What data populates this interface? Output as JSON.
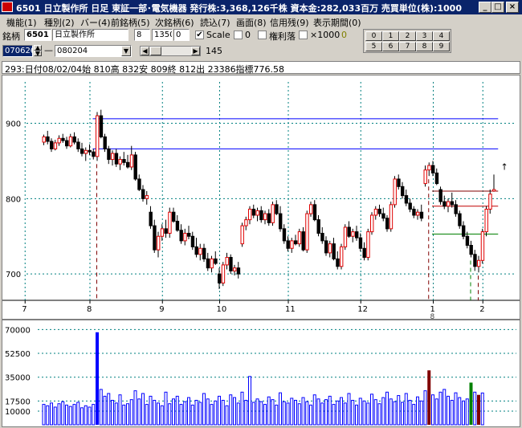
{
  "window": {
    "code": "6501",
    "title": "6501 日立製作所 日足 東証一部･電気機器 発行株:3,368,126千株 資本金:282,033百万 売買単位(株):1000",
    "min_btn": "_",
    "max_btn": "□",
    "close_btn": "×"
  },
  "menu": [
    "機能(1)",
    "種別(2)",
    "バー(4)",
    "前銘柄(5)",
    "次銘柄(6)",
    "読込(7)",
    "画面(8)",
    "信用残(9)",
    "表示期間(0)"
  ],
  "toolbar": {
    "code_label": "銘柄",
    "code_value": "6501",
    "name_value": "日立製作所",
    "field_a": "8",
    "field_b": "1350",
    "field_c": "0",
    "scale_label": "Scale",
    "zero_label": "0",
    "kinri_label": "権利落",
    "x1000_label": "×1000",
    "x1000_value": "0",
    "start_date": "070626",
    "end_date": "080204",
    "slider_value": "145",
    "scale_checked": "✔",
    "numkeys": [
      "0",
      "1",
      "2",
      "3",
      "4",
      "5",
      "6",
      "7",
      "8",
      "9"
    ]
  },
  "info_line": "293:日付08/02/04始 810高 832安 809終 812出 23386指標776.58",
  "chart_data": [
    {
      "type": "candlestick",
      "y_ticks": [
        "900",
        "800",
        "700"
      ],
      "ylim": [
        665,
        940
      ],
      "x_tick_labels": [
        "7",
        "8",
        "9",
        "10",
        "11",
        "12",
        "1",
        "2"
      ],
      "year_label": "8",
      "horizontal_levels": [
        906,
        866,
        810,
        790,
        753
      ],
      "last_marker": "↑",
      "colors": {
        "up": "#e00000",
        "down": "#000000",
        "level": "#0000ff",
        "grid": "#008080",
        "signal": "#800000",
        "signal2": "#008000"
      },
      "ohlc": [
        [
          875,
          885,
          871,
          882
        ],
        [
          882,
          890,
          872,
          876
        ],
        [
          876,
          880,
          862,
          866
        ],
        [
          866,
          878,
          864,
          874
        ],
        [
          874,
          884,
          870,
          880
        ],
        [
          880,
          886,
          874,
          877
        ],
        [
          877,
          882,
          866,
          870
        ],
        [
          870,
          886,
          868,
          882
        ],
        [
          882,
          888,
          872,
          875
        ],
        [
          875,
          880,
          862,
          866
        ],
        [
          866,
          874,
          856,
          860
        ],
        [
          860,
          868,
          850,
          864
        ],
        [
          864,
          872,
          858,
          862
        ],
        [
          862,
          866,
          852,
          856
        ],
        [
          856,
          915,
          850,
          910
        ],
        [
          910,
          918,
          880,
          882
        ],
        [
          882,
          886,
          862,
          866
        ],
        [
          866,
          870,
          846,
          852
        ],
        [
          852,
          864,
          844,
          860
        ],
        [
          860,
          866,
          842,
          846
        ],
        [
          846,
          856,
          838,
          852
        ],
        [
          852,
          862,
          844,
          848
        ],
        [
          848,
          858,
          840,
          842
        ],
        [
          842,
          870,
          838,
          858
        ],
        [
          858,
          862,
          824,
          826
        ],
        [
          826,
          832,
          810,
          812
        ],
        [
          812,
          818,
          796,
          800
        ],
        [
          800,
          810,
          792,
          804
        ],
        [
          782,
          790,
          760,
          764
        ],
        [
          764,
          772,
          728,
          732
        ],
        [
          732,
          756,
          722,
          750
        ],
        [
          750,
          766,
          744,
          760
        ],
        [
          760,
          772,
          748,
          754
        ],
        [
          754,
          788,
          748,
          782
        ],
        [
          782,
          788,
          768,
          770
        ],
        [
          770,
          778,
          756,
          758
        ],
        [
          758,
          766,
          740,
          744
        ],
        [
          744,
          760,
          738,
          754
        ],
        [
          754,
          764,
          746,
          750
        ],
        [
          750,
          756,
          732,
          736
        ],
        [
          736,
          748,
          722,
          726
        ],
        [
          726,
          740,
          718,
          734
        ],
        [
          734,
          740,
          716,
          720
        ],
        [
          720,
          728,
          704,
          708
        ],
        [
          708,
          724,
          702,
          720
        ],
        [
          720,
          730,
          712,
          714
        ],
        [
          700,
          708,
          680,
          688
        ],
        [
          688,
          716,
          684,
          712
        ],
        [
          712,
          728,
          706,
          722
        ],
        [
          722,
          726,
          700,
          704
        ],
        [
          704,
          712,
          698,
          708
        ],
        [
          708,
          716,
          694,
          700
        ],
        [
          740,
          768,
          736,
          764
        ],
        [
          764,
          776,
          758,
          772
        ],
        [
          772,
          790,
          766,
          786
        ],
        [
          786,
          792,
          774,
          778
        ],
        [
          778,
          788,
          770,
          784
        ],
        [
          784,
          790,
          768,
          772
        ],
        [
          772,
          784,
          766,
          780
        ],
        [
          780,
          786,
          764,
          768
        ],
        [
          768,
          796,
          764,
          792
        ],
        [
          792,
          798,
          778,
          780
        ],
        [
          780,
          790,
          756,
          760
        ],
        [
          760,
          766,
          740,
          744
        ],
        [
          744,
          750,
          730,
          734
        ],
        [
          734,
          748,
          728,
          744
        ],
        [
          744,
          752,
          738,
          740
        ],
        [
          740,
          760,
          736,
          756
        ],
        [
          756,
          762,
          730,
          732
        ],
        [
          732,
          784,
          728,
          780
        ],
        [
          780,
          796,
          776,
          792
        ],
        [
          792,
          798,
          770,
          772
        ],
        [
          772,
          778,
          750,
          754
        ],
        [
          754,
          762,
          740,
          744
        ],
        [
          744,
          750,
          724,
          728
        ],
        [
          728,
          744,
          722,
          740
        ],
        [
          740,
          748,
          718,
          720
        ],
        [
          720,
          730,
          706,
          710
        ],
        [
          710,
          740,
          706,
          736
        ],
        [
          736,
          766,
          732,
          762
        ],
        [
          762,
          770,
          748,
          750
        ],
        [
          750,
          760,
          742,
          756
        ],
        [
          756,
          764,
          744,
          748
        ],
        [
          748,
          754,
          730,
          734
        ],
        [
          734,
          742,
          718,
          722
        ],
        [
          722,
          760,
          718,
          756
        ],
        [
          756,
          782,
          752,
          778
        ],
        [
          778,
          790,
          772,
          786
        ],
        [
          786,
          792,
          776,
          780
        ],
        [
          780,
          788,
          770,
          774
        ],
        [
          774,
          778,
          756,
          760
        ],
        [
          760,
          796,
          756,
          792
        ],
        [
          792,
          830,
          788,
          826
        ],
        [
          826,
          832,
          812,
          816
        ],
        [
          816,
          822,
          800,
          804
        ],
        [
          804,
          812,
          790,
          794
        ],
        [
          794,
          800,
          782,
          786
        ],
        [
          786,
          790,
          774,
          778
        ],
        [
          778,
          786,
          772,
          782
        ],
        [
          782,
          792,
          770,
          774
        ],
        [
          820,
          844,
          816,
          838
        ],
        [
          838,
          848,
          830,
          844
        ],
        [
          844,
          850,
          830,
          834
        ],
        [
          834,
          840,
          818,
          820
        ],
        [
          812,
          816,
          792,
          796
        ],
        [
          796,
          804,
          786,
          790
        ],
        [
          790,
          800,
          782,
          796
        ],
        [
          796,
          808,
          788,
          792
        ],
        [
          792,
          798,
          776,
          780
        ],
        [
          780,
          784,
          760,
          764
        ],
        [
          764,
          770,
          746,
          750
        ],
        [
          750,
          756,
          734,
          738
        ],
        [
          738,
          744,
          722,
          726
        ],
        [
          726,
          732,
          704,
          710
        ],
        [
          710,
          724,
          702,
          718
        ],
        [
          718,
          760,
          714,
          756
        ],
        [
          756,
          790,
          750,
          786
        ],
        [
          786,
          812,
          780,
          806
        ],
        [
          810,
          832,
          809,
          812
        ]
      ],
      "signals": [
        {
          "index": 14,
          "kind": "signal"
        },
        {
          "index": 101,
          "kind": "signal"
        },
        {
          "index": 112,
          "kind": "signal2"
        },
        {
          "index": 114,
          "kind": "signal"
        }
      ]
    },
    {
      "type": "bar",
      "title": "",
      "y_ticks": [
        "70000",
        "52500",
        "35000",
        "17500",
        "10000"
      ],
      "ylim": [
        0,
        72000
      ],
      "highlighted": [
        {
          "index": 14,
          "value": 68000,
          "color": "#0000ff"
        },
        {
          "index": 101,
          "value": 40000,
          "color": "#800000"
        },
        {
          "index": 112,
          "value": 31000,
          "color": "#008000"
        },
        {
          "index": 114,
          "value": 22000,
          "color": "#800000"
        }
      ],
      "values": [
        15000,
        14000,
        16000,
        13000,
        15500,
        17000,
        14500,
        13500,
        15000,
        16500,
        12500,
        14000,
        13000,
        15000,
        68000,
        26000,
        21000,
        23000,
        18000,
        16000,
        22000,
        14500,
        15500,
        18500,
        25000,
        19000,
        23000,
        15000,
        21000,
        18000,
        16000,
        14000,
        24000,
        15500,
        19000,
        21000,
        15000,
        17000,
        20000,
        14500,
        18000,
        16500,
        23000,
        19000,
        15000,
        17500,
        21000,
        18000,
        14000,
        22000,
        20000,
        16000,
        24000,
        18000,
        35500,
        16500,
        19000,
        17000,
        15000,
        20500,
        18500,
        14500,
        23500,
        17000,
        16000,
        19500,
        18000,
        15500,
        20000,
        17000,
        14500,
        22000,
        19000,
        16000,
        18500,
        21000,
        15000,
        17500,
        20000,
        16000,
        23000,
        18000,
        14500,
        19500,
        17500,
        16000,
        22500,
        18500,
        15500,
        20000,
        24000,
        19000,
        17000,
        21500,
        16500,
        23000,
        18000,
        15000,
        20500,
        17500,
        25000,
        40000,
        22000,
        19000,
        24000,
        26000,
        21000,
        18000,
        23500,
        20000,
        17500,
        19000,
        31000,
        24000,
        22000,
        23386
      ]
    }
  ]
}
